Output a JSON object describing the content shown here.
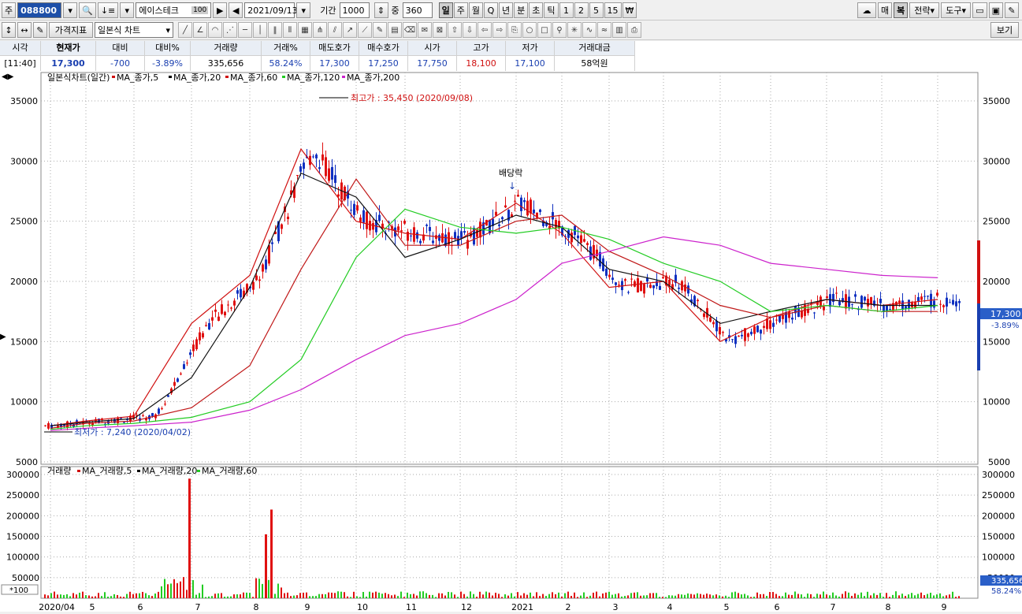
{
  "toolbar": {
    "market_label": "주",
    "stock_code": "088800",
    "stock_name": "에이스테크",
    "name_badge": "100",
    "date": "2021/09/13",
    "period_label": "기간",
    "period_value": "1000",
    "mid_label": "중",
    "mid_value": "360",
    "periods": [
      "일",
      "주",
      "월",
      "Q",
      "년",
      "분",
      "초",
      "틱",
      "1",
      "2",
      "5",
      "15",
      "₩"
    ],
    "selected_period": "일",
    "right_buttons": [
      "매",
      "복",
      "전략",
      "도구"
    ],
    "indicator_button": "가격지표",
    "chart_type": "일본식 차트",
    "view_button": "보기"
  },
  "quote": {
    "headers": [
      "시각",
      "현재가",
      "대비",
      "대비%",
      "거래량",
      "거래%",
      "매도호가",
      "매수호가",
      "시가",
      "고가",
      "저가",
      "거래대금"
    ],
    "values": [
      "[11:40]",
      "17,300",
      "-700",
      "-3.89%",
      "335,656",
      "58.24%",
      "17,300",
      "17,250",
      "17,750",
      "18,100",
      "17,100",
      "58억원"
    ],
    "colors": [
      "#000000",
      "#1a3fb0",
      "#1a3fb0",
      "#1a3fb0",
      "#000000",
      "#1a3fb0",
      "#1a3fb0",
      "#1a3fb0",
      "#1a3fb0",
      "#d01010",
      "#1a3fb0",
      "#000000"
    ]
  },
  "price_panel": {
    "legend_title": "일본식차트(일간)",
    "ma_legend": [
      {
        "name": "MA_종가,5",
        "color": "#d01010"
      },
      {
        "name": "MA_종가,20",
        "color": "#000000"
      },
      {
        "name": "MA_종가,60",
        "color": "#d01010"
      },
      {
        "name": "MA_종가,120",
        "color": "#22cc22"
      },
      {
        "name": "MA_종가,200",
        "color": "#cc22cc"
      }
    ],
    "high_annotation": "최고가 : 35,450 (2020/09/08)",
    "low_annotation": "최저가 : 7,240 (2020/04/02)",
    "dividend_label": "배당락",
    "current_price_tag": "17,300",
    "change_pct_tag": "-3.89%",
    "y_ticks": [
      "35000",
      "30000",
      "25000",
      "20000",
      "15000",
      "10000",
      "5000"
    ]
  },
  "volume_panel": {
    "legend_title": "거래량",
    "ma_legend": [
      {
        "name": "MA_거래량,5",
        "color": "#d01010"
      },
      {
        "name": "MA_거래량,20",
        "color": "#000000"
      },
      {
        "name": "MA_거래량,60",
        "color": "#22cc22"
      }
    ],
    "y_ticks": [
      "300000",
      "250000",
      "200000",
      "150000",
      "100000",
      "50000"
    ],
    "scale_label": "*100",
    "volume_tag": "335,656",
    "volume_pct_tag": "58.24%"
  },
  "x_axis_labels": [
    "2020/04",
    "5",
    "6",
    "7",
    "8",
    "9",
    "10",
    "11",
    "12",
    "2021",
    "2",
    "3",
    "4",
    "5",
    "6",
    "7",
    "8",
    "9"
  ],
  "chart_data": {
    "type": "line",
    "title": "일본식차트(일간)",
    "x": [
      "2020/04",
      "5",
      "6",
      "7",
      "8",
      "9",
      "10",
      "11",
      "12",
      "2021",
      "2",
      "3",
      "4",
      "5",
      "6",
      "7",
      "8",
      "9"
    ],
    "series": [
      {
        "name": "MA_종가,5",
        "values": [
          8000,
          8400,
          8800,
          16500,
          20500,
          31000,
          25000,
          24000,
          23500,
          26500,
          24000,
          19500,
          20000,
          15000,
          17000,
          18500,
          18000,
          18500
        ]
      },
      {
        "name": "MA_종가,20",
        "values": [
          8000,
          8300,
          8600,
          12000,
          19500,
          29000,
          27000,
          22000,
          23500,
          25500,
          24500,
          21000,
          20000,
          16500,
          17500,
          18500,
          18000,
          18000
        ]
      },
      {
        "name": "MA_종가,60",
        "values": [
          7800,
          8200,
          8400,
          9500,
          13000,
          21000,
          28500,
          23000,
          23000,
          25000,
          25500,
          22500,
          20500,
          18000,
          17000,
          18000,
          17500,
          17500
        ]
      },
      {
        "name": "MA_종가,120",
        "values": [
          7700,
          8000,
          8200,
          8700,
          10000,
          13500,
          22000,
          26000,
          24500,
          24000,
          24500,
          23500,
          21500,
          20000,
          17500,
          18000,
          17500,
          18000
        ]
      },
      {
        "name": "MA_종가,200",
        "values": [
          7600,
          7800,
          8000,
          8300,
          9300,
          11000,
          13500,
          15500,
          16500,
          18500,
          21500,
          22500,
          23700,
          23000,
          21500,
          21000,
          20500,
          20300
        ]
      }
    ],
    "volume": {
      "name": "거래량",
      "unit": "*100",
      "spikes": [
        {
          "x": "7",
          "value": 290000
        },
        {
          "x": "8",
          "value": 215000
        },
        {
          "x": "8",
          "value": 155000
        }
      ]
    },
    "ylim": [
      5000,
      36000
    ]
  }
}
